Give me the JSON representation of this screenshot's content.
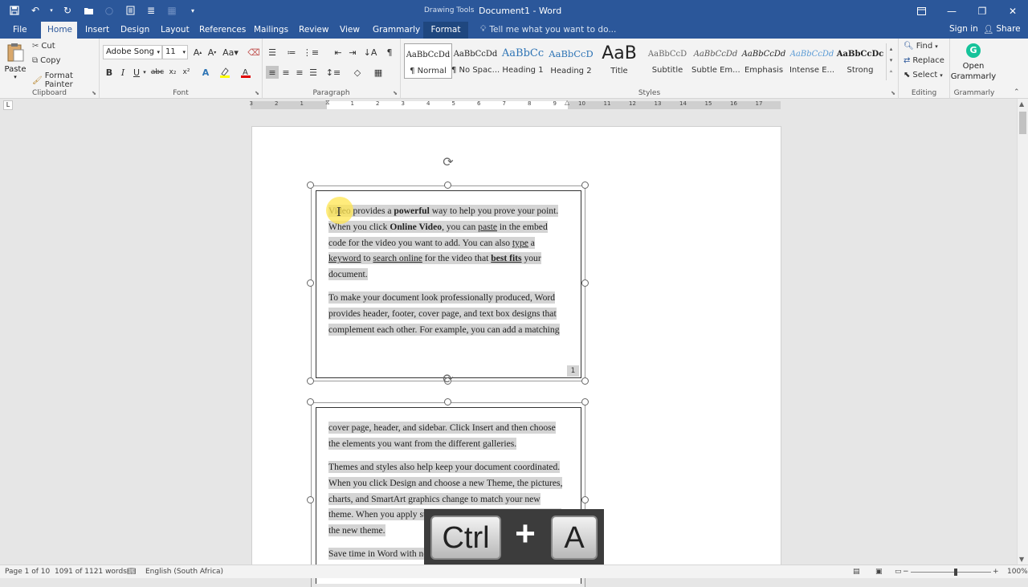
{
  "titlebar": {
    "context_tab": "Drawing Tools",
    "document_title": "Document1 - Word"
  },
  "tabs": [
    "File",
    "Home",
    "Insert",
    "Design",
    "Layout",
    "References",
    "Mailings",
    "Review",
    "View",
    "Grammarly",
    "Format"
  ],
  "tell_me": "Tell me what you want to do...",
  "sign_in": "Sign in",
  "share": "Share",
  "clipboard": {
    "paste": "Paste",
    "cut": "Cut",
    "copy": "Copy",
    "format_painter": "Format Painter",
    "label": "Clipboard"
  },
  "font": {
    "name": "Adobe Song",
    "size": "11",
    "label": "Font"
  },
  "paragraph": {
    "label": "Paragraph"
  },
  "styles": {
    "label": "Styles",
    "items": [
      {
        "sample": "AaBbCcDd",
        "name": "¶ Normal"
      },
      {
        "sample": "AaBbCcDd",
        "name": "¶ No Spac..."
      },
      {
        "sample": "AaBbCc",
        "name": "Heading 1"
      },
      {
        "sample": "AaBbCcD",
        "name": "Heading 2"
      },
      {
        "sample": "AaB",
        "name": "Title"
      },
      {
        "sample": "AaBbCcD",
        "name": "Subtitle"
      },
      {
        "sample": "AaBbCcDd",
        "name": "Subtle Em..."
      },
      {
        "sample": "AaBbCcDd",
        "name": "Emphasis"
      },
      {
        "sample": "AaBbCcDd",
        "name": "Intense E..."
      },
      {
        "sample": "AaBbCcDc",
        "name": "Strong"
      }
    ]
  },
  "editing": {
    "find": "Find",
    "replace": "Replace",
    "select": "Select",
    "label": "Editing"
  },
  "grammarly": {
    "open_line1": "Open",
    "open_line2": "Grammarly",
    "label": "Grammarly"
  },
  "ruler_numbers": [
    "3",
    "2",
    "1",
    "1",
    "2",
    "3",
    "4",
    "5",
    "6",
    "7",
    "8",
    "9",
    "10",
    "11",
    "12",
    "13",
    "14",
    "15",
    "16",
    "17"
  ],
  "tab_selector": "L",
  "textbox1": {
    "p1_lines": [
      [
        "Video provides a ",
        {
          "b": "powerful"
        },
        " way to help you prove your point."
      ],
      [
        "When you click ",
        {
          "b": "Online Video"
        },
        ", you can ",
        {
          "u": "paste"
        },
        " in the embed"
      ],
      [
        "code for the video you want to add. You can also ",
        {
          "u": "type"
        },
        " a"
      ],
      [
        {
          "u": "keyword"
        },
        " to ",
        {
          "u": "search online"
        },
        " for the video that ",
        {
          "bu": "best fits"
        },
        " your"
      ],
      [
        "document."
      ]
    ],
    "p2_lines": [
      "To make your document look professionally produced, Word",
      "provides header, footer, cover page, and text box designs that",
      "complement each other. For example, you can add a matching"
    ],
    "page_number": "1"
  },
  "textbox2": {
    "p1_lines": [
      "cover page, header, and sidebar. Click Insert and then choose",
      "the elements you want from the different galleries."
    ],
    "p2_lines": [
      "Themes and styles also help keep your document coordinated.",
      "When you click Design and choose a new Theme, the pictures,",
      "charts, and SmartArt graphics change to match your new",
      "theme. When you apply styles, your headings change to match",
      "the new theme."
    ],
    "p3_lines": [
      "Save time in Word with new buttons that show up where you"
    ]
  },
  "keystroke": {
    "key1": "Ctrl",
    "plus": "+",
    "key2": "A"
  },
  "statusbar": {
    "page": "Page 1 of 10",
    "words": "1091 of 1121 words",
    "language": "English (South Africa)",
    "zoom": "100%"
  }
}
